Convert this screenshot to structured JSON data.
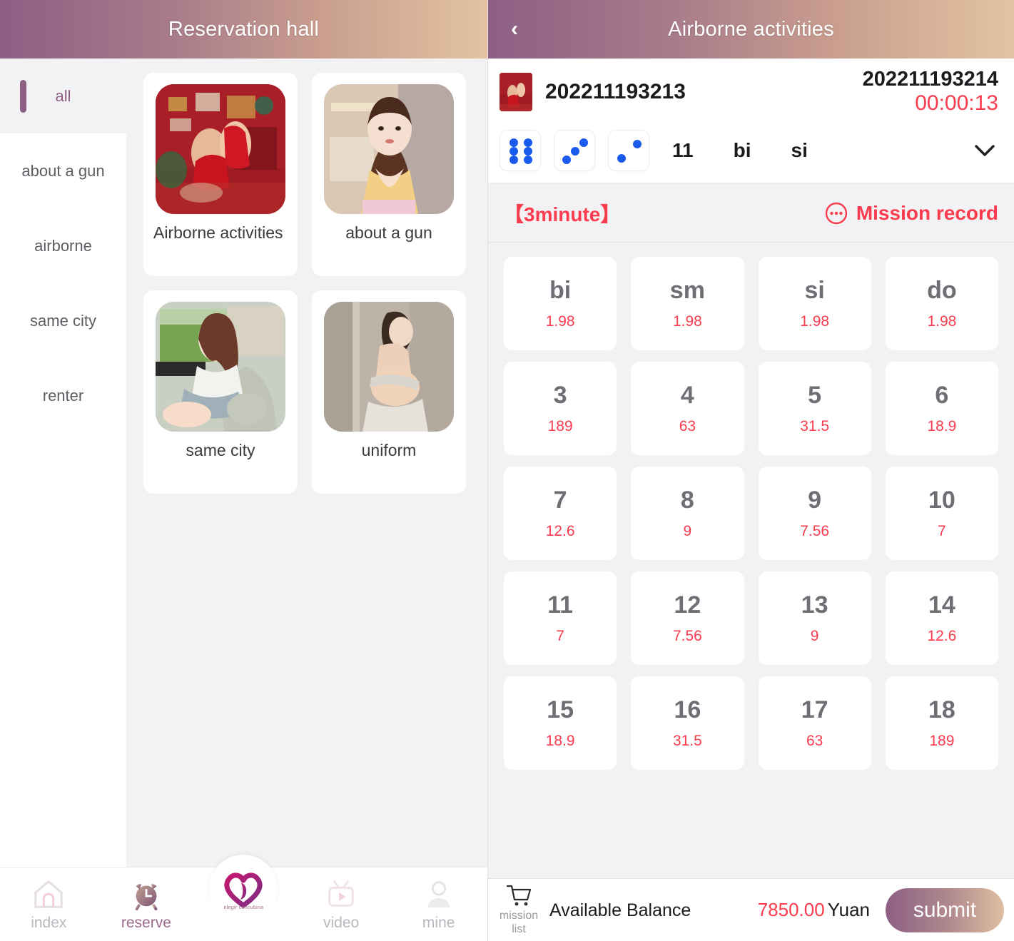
{
  "left": {
    "header": {
      "title": "Reservation hall"
    },
    "categories": [
      {
        "label": "all",
        "active": true
      },
      {
        "label": "about a gun",
        "active": false
      },
      {
        "label": "airborne",
        "active": false
      },
      {
        "label": "same city",
        "active": false
      },
      {
        "label": "renter",
        "active": false
      }
    ],
    "cards": [
      {
        "title": "Airborne activities",
        "align": "left",
        "thumb": "red-room-photo"
      },
      {
        "title": "about a gun",
        "align": "center",
        "thumb": "portrait-photo"
      },
      {
        "title": "same city",
        "align": "center",
        "thumb": "car-photo"
      },
      {
        "title": "uniform",
        "align": "center",
        "thumb": "wall-photo"
      }
    ]
  },
  "bottom_nav": [
    {
      "label": "index",
      "icon": "home-icon",
      "active": false
    },
    {
      "label": "reserve",
      "icon": "alarm-clock-icon",
      "active": true
    },
    {
      "label": "",
      "icon": "heart-logo-icon",
      "active": false,
      "sub": "elegir concubina"
    },
    {
      "label": "video",
      "icon": "video-icon",
      "active": false
    },
    {
      "label": "mine",
      "icon": "person-icon",
      "active": false
    }
  ],
  "right": {
    "header": {
      "title": "Airborne activities",
      "back_icon": "chevron-left-icon"
    },
    "issue": {
      "current_no": "202211193213",
      "next_no": "202211193214",
      "timer": "00:00:13"
    },
    "dice": {
      "values": [
        6,
        3,
        2
      ],
      "sum": "11",
      "tags": [
        "bi",
        "si"
      ],
      "expand_icon": "chevron-down-icon"
    },
    "mission": {
      "minute_label": "【3minute】",
      "record_label": "Mission record",
      "record_icon": "ellipsis-circle-icon"
    },
    "bets": [
      {
        "name": "bi",
        "odds": "1.98"
      },
      {
        "name": "sm",
        "odds": "1.98"
      },
      {
        "name": "si",
        "odds": "1.98"
      },
      {
        "name": "do",
        "odds": "1.98"
      },
      {
        "name": "3",
        "odds": "189"
      },
      {
        "name": "4",
        "odds": "63"
      },
      {
        "name": "5",
        "odds": "31.5"
      },
      {
        "name": "6",
        "odds": "18.9"
      },
      {
        "name": "7",
        "odds": "12.6"
      },
      {
        "name": "8",
        "odds": "9"
      },
      {
        "name": "9",
        "odds": "7.56"
      },
      {
        "name": "10",
        "odds": "7"
      },
      {
        "name": "11",
        "odds": "7"
      },
      {
        "name": "12",
        "odds": "7.56"
      },
      {
        "name": "13",
        "odds": "9"
      },
      {
        "name": "14",
        "odds": "12.6"
      },
      {
        "name": "15",
        "odds": "18.9"
      },
      {
        "name": "16",
        "odds": "31.5"
      },
      {
        "name": "17",
        "odds": "63"
      },
      {
        "name": "18",
        "odds": "189"
      }
    ],
    "wallet": {
      "mission_list_label": "mission list",
      "cart_icon": "shopping-cart-icon",
      "available_label": "Available Balance",
      "amount": "7850.00",
      "unit": "Yuan",
      "submit_label": "submit"
    }
  },
  "colors": {
    "header_from": "#8d5f84",
    "header_to": "#e3c3a1",
    "accent_red": "#fb3b4e",
    "dice_blue": "#1a5bed",
    "bet_name": "#6e6e74",
    "page_bg": "#f2f2f4"
  }
}
